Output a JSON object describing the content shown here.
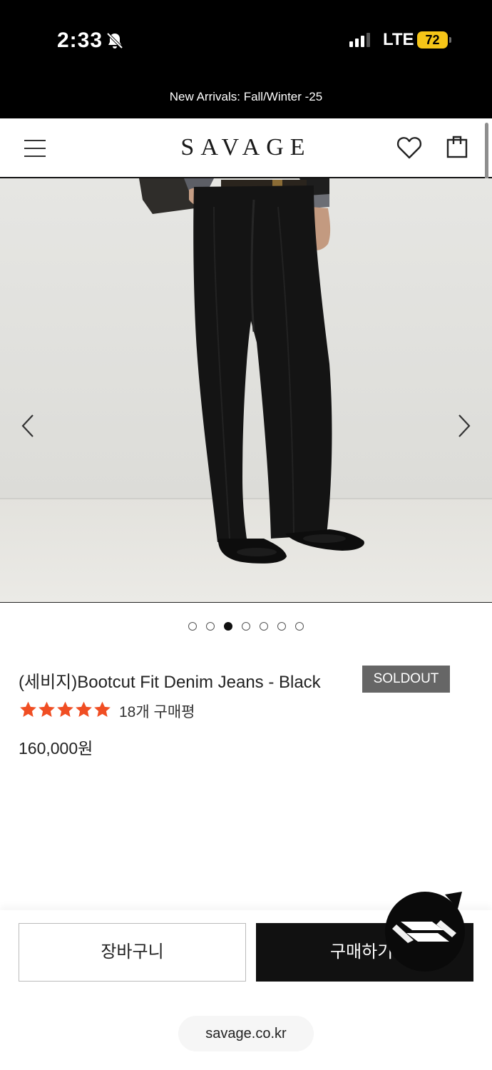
{
  "status_bar": {
    "time": "2:33",
    "network": "LTE",
    "battery": "72"
  },
  "promo": {
    "text": "New Arrivals: Fall/Winter -25"
  },
  "header": {
    "logo": "SAVAGE"
  },
  "gallery": {
    "total_images": 7,
    "active_index": 2
  },
  "product": {
    "name": "(세비지)Bootcut Fit Denim Jeans - Black",
    "badge": "SOLDOUT",
    "rating": 5,
    "rating_max": 5,
    "reviews": "18개 구매평",
    "price": "160,000원"
  },
  "actions": {
    "cart_label": "장바구니",
    "buy_label": "구매하기"
  },
  "browser": {
    "url": "savage.co.kr"
  },
  "colors": {
    "star": "#f04e23",
    "badge_bg": "#666666",
    "buy_bg": "#111111"
  },
  "icons": [
    "bell-slash-icon",
    "signal-icon",
    "menu-icon",
    "heart-icon",
    "shopping-bag-icon",
    "chevron-left-icon",
    "chevron-right-icon",
    "star-icon",
    "chat-icon"
  ]
}
